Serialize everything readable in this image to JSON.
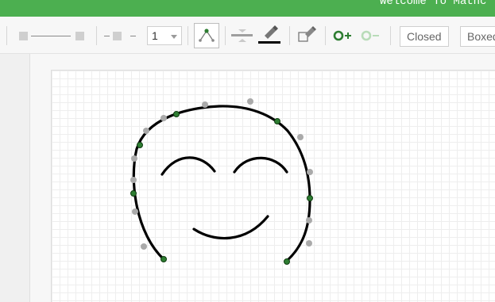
{
  "banner": {
    "text": "Welcome To Mathc"
  },
  "toolbar": {
    "line_width_value": "1",
    "closed_label": "Closed",
    "boxed_label": "Boxed"
  },
  "icons": [
    "line-start-square-icon",
    "line-end-square-icon",
    "arrow-style-icon",
    "curve-tool-icon",
    "line-style-icon",
    "stroke-color-icon",
    "fill-icon",
    "add-point-icon",
    "remove-point-icon"
  ],
  "colors": {
    "banner": "#4caf50",
    "stroke": "#000000",
    "control_point_active": "#2e7d32",
    "control_point_inactive": "#aaaaaa"
  }
}
